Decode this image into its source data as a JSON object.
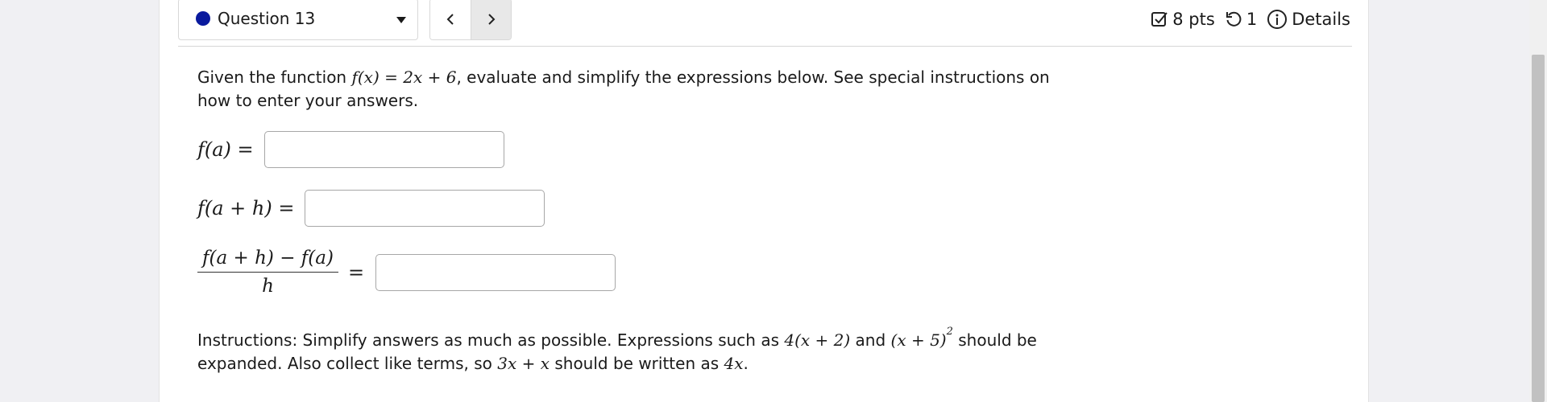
{
  "header": {
    "question_label": "Question 13",
    "prev_icon": "chevron-left-icon",
    "next_icon": "chevron-right-icon",
    "points": "8 pts",
    "attempts": "1",
    "details_label": "Details",
    "dot_color": "#0a1a9e"
  },
  "question": {
    "prompt_before": "Given the function ",
    "function_math": "f(x) = 2x + 6",
    "prompt_after": ", evaluate and simplify the expressions below. See special instructions on how to enter your answers.",
    "parts": [
      {
        "label": "f(a) =",
        "value": ""
      },
      {
        "label": "f(a + h) =",
        "value": ""
      },
      {
        "numerator": "f(a + h) − f(a)",
        "denominator": "h",
        "equals": "=",
        "value": ""
      }
    ],
    "instructions": {
      "t1": "Instructions: Simplify answers as much as possible. Expressions such as ",
      "m1": "4(x + 2)",
      "t2": " and ",
      "m2": "(x + 5)",
      "m2_exp": "2",
      "t3": " should be expanded. Also collect like terms, so ",
      "m3": "3x + x",
      "t4": " should be written as ",
      "m4": "4x",
      "t5": "."
    }
  }
}
